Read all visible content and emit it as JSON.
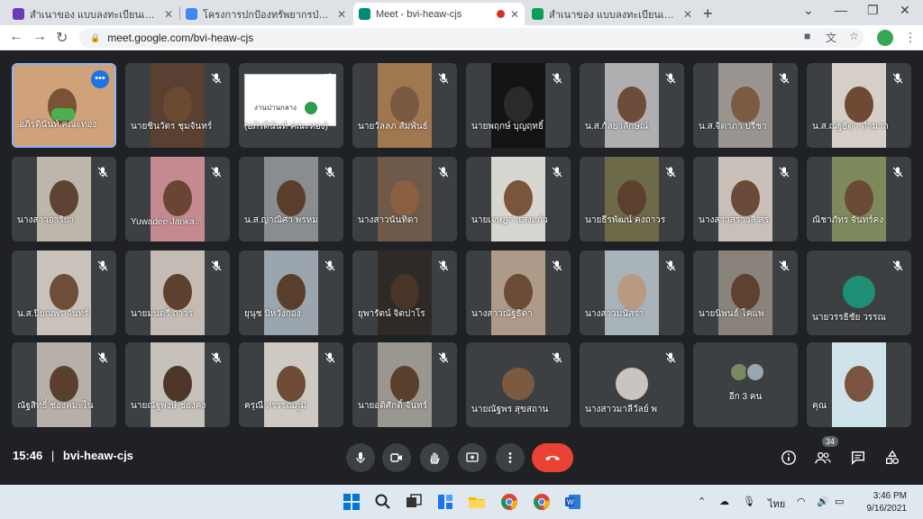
{
  "browser": {
    "tabs": [
      {
        "title": "สำเนาของ แบบลงทะเบียนเข้าร่วมกิจกรรม",
        "favicon_color": "#673ab7",
        "active": false,
        "recording": false
      },
      {
        "title": "โครงการปกป้องทรัพยากรป่าลดเหียนต่อ",
        "favicon_color": "#4285f4",
        "active": false,
        "recording": false
      },
      {
        "title": "Meet - bvi-heaw-cjs",
        "favicon_color": "#00897b",
        "active": true,
        "recording": true
      },
      {
        "title": "สำเนาของ แบบลงทะเบียนเข้าร่วมกิจกรรม",
        "favicon_color": "#0f9d58",
        "active": false,
        "recording": false
      }
    ],
    "new_tab_label": "+",
    "url": "meet.google.com/bvi-heaw-cjs"
  },
  "participants": [
    {
      "name": "อภิรดินันท์ คณะทอง",
      "self": true,
      "muted": false,
      "type": "video",
      "bg": "#cfa27a",
      "skin": "#7a5236"
    },
    {
      "name": "นายชินวัตร ชุมจันทร์",
      "muted": true,
      "type": "video",
      "bg": "#5a4030",
      "skin": "#6b4a33"
    },
    {
      "name": "(อภิรดินันท์ คณะทอง)",
      "muted": true,
      "type": "slide",
      "bg": "#ffffff",
      "slide_text": "งานปานกลาง"
    },
    {
      "name": "นายวัลลภ สัมพันธ์",
      "muted": true,
      "type": "video",
      "bg": "#a07850",
      "skin": "#7a5a40"
    },
    {
      "name": "นายพฤกษ์ บุญฤทธิ์",
      "muted": true,
      "type": "video",
      "bg": "#141414",
      "skin": "#2a2a2a"
    },
    {
      "name": "น.ส.กัลยาลักษณ์",
      "muted": true,
      "type": "video",
      "bg": "#b0aeb0",
      "skin": "#6c4d3b"
    },
    {
      "name": "น.ส.จิดาภา ปรีชา",
      "muted": true,
      "type": "video",
      "bg": "#9a9590",
      "skin": "#7d5a44"
    },
    {
      "name": "น.ส.ณัฐธิดา ดำมาก",
      "muted": true,
      "type": "video",
      "bg": "#d5cfc8",
      "skin": "#6e4a35"
    },
    {
      "name": "นางสาวอาริยา",
      "muted": true,
      "type": "video",
      "bg": "#bfb6ab",
      "skin": "#5e4332"
    },
    {
      "name": "Yuwadee Janka...",
      "muted": true,
      "type": "video",
      "bg": "#c48a90",
      "skin": "#6a4434"
    },
    {
      "name": "น.ส.ญาณิศา พรหม",
      "muted": true,
      "type": "video",
      "bg": "#8a8d90",
      "skin": "#5a3e2c"
    },
    {
      "name": "นางสาวนันทิดา",
      "muted": true,
      "type": "video",
      "bg": "#6f5a4a",
      "skin": "#8a5f42"
    },
    {
      "name": "นายเจษฎา แสงแก้ว",
      "muted": true,
      "type": "video",
      "bg": "#d8d6d0",
      "skin": "#7a553c"
    },
    {
      "name": "นายธีรพัฒน์ คงถาวร",
      "muted": true,
      "type": "video",
      "bg": "#6d6a4a",
      "skin": "#5c3f2d"
    },
    {
      "name": "นางสาวสราวลี สร",
      "muted": true,
      "type": "video",
      "bg": "#c8c0b8",
      "skin": "#6a4a38"
    },
    {
      "name": "ณิชาภัทร จันทร์คง",
      "muted": true,
      "type": "video",
      "bg": "#7f8a5c",
      "skin": "#6b4a36"
    },
    {
      "name": "น.ส.ปิยณพร จันทร์",
      "muted": true,
      "type": "video",
      "bg": "#c9c2bb",
      "skin": "#6e4d3a"
    },
    {
      "name": "นายมนตรี ถาวร",
      "muted": true,
      "type": "video",
      "bg": "#c4bcb4",
      "skin": "#5d4030"
    },
    {
      "name": "ยุนุช บิหวังกอง",
      "muted": true,
      "type": "video",
      "bg": "#9ba5ad",
      "skin": "#5a3e2c"
    },
    {
      "name": "ยุพารัตน์ จิตปาโร",
      "muted": true,
      "type": "video",
      "bg": "#2e2a28",
      "skin": "#4a3428"
    },
    {
      "name": "นางสาวณัฐธิดา",
      "muted": true,
      "type": "video",
      "bg": "#ad9a88",
      "skin": "#6c4b37"
    },
    {
      "name": "นางสาวมนัสรา",
      "muted": true,
      "type": "video",
      "bg": "#a8b3ba",
      "skin": "#b99a80"
    },
    {
      "name": "นายนิพนธ์ โคแพ",
      "muted": true,
      "type": "video",
      "bg": "#8a837c",
      "skin": "#5e4130"
    },
    {
      "name": "นายวรรธิชัย วรรณ",
      "muted": true,
      "type": "avatar",
      "bg": "#3c4043",
      "avatar_color": "#1e8e74"
    },
    {
      "name": "ณัฐสิทธิ์ ช่องคมะไน",
      "muted": true,
      "type": "video",
      "bg": "#b7b0aa",
      "skin": "#5a3f2e"
    },
    {
      "name": "นายณัฐพงษ์ ช่องคง",
      "muted": true,
      "type": "video",
      "bg": "#c6c1bb",
      "skin": "#4d3628"
    },
    {
      "name": "ครุณี สรรรณภูมิ",
      "muted": true,
      "type": "video",
      "bg": "#cfc9c3",
      "skin": "#6e4c38"
    },
    {
      "name": "นายอดิศักดิ์ จันทร์",
      "muted": true,
      "type": "video",
      "bg": "#9a9690",
      "skin": "#5b3f2d"
    },
    {
      "name": "นายณัฐพร สุขสถาน",
      "muted": true,
      "type": "avatar",
      "bg": "#3c4043",
      "avatar_color": "#7b5a40"
    },
    {
      "name": "นางสาวมาลีวัลย์ พ",
      "muted": true,
      "type": "avatar",
      "bg": "#3c4043",
      "avatar_color": "#c9c4c0"
    },
    {
      "name": "อีก 3 คน",
      "muted": false,
      "type": "more",
      "bg": "#3c4043"
    },
    {
      "name": "คุณ",
      "muted": false,
      "type": "video",
      "bg": "#cfe3ea",
      "skin": "#7a5440"
    }
  ],
  "bottom": {
    "time": "15:46",
    "separator": "|",
    "meeting_code": "bvi-heaw-cjs",
    "participant_count": "34"
  },
  "taskbar": {
    "lang": "ไทย",
    "time": "3:46 PM",
    "date": "9/16/2021"
  },
  "colors": {
    "meet_bg": "#202124",
    "tile_bg": "#3c4043",
    "end_call": "#ea4335",
    "accent": "#1a73e8"
  }
}
